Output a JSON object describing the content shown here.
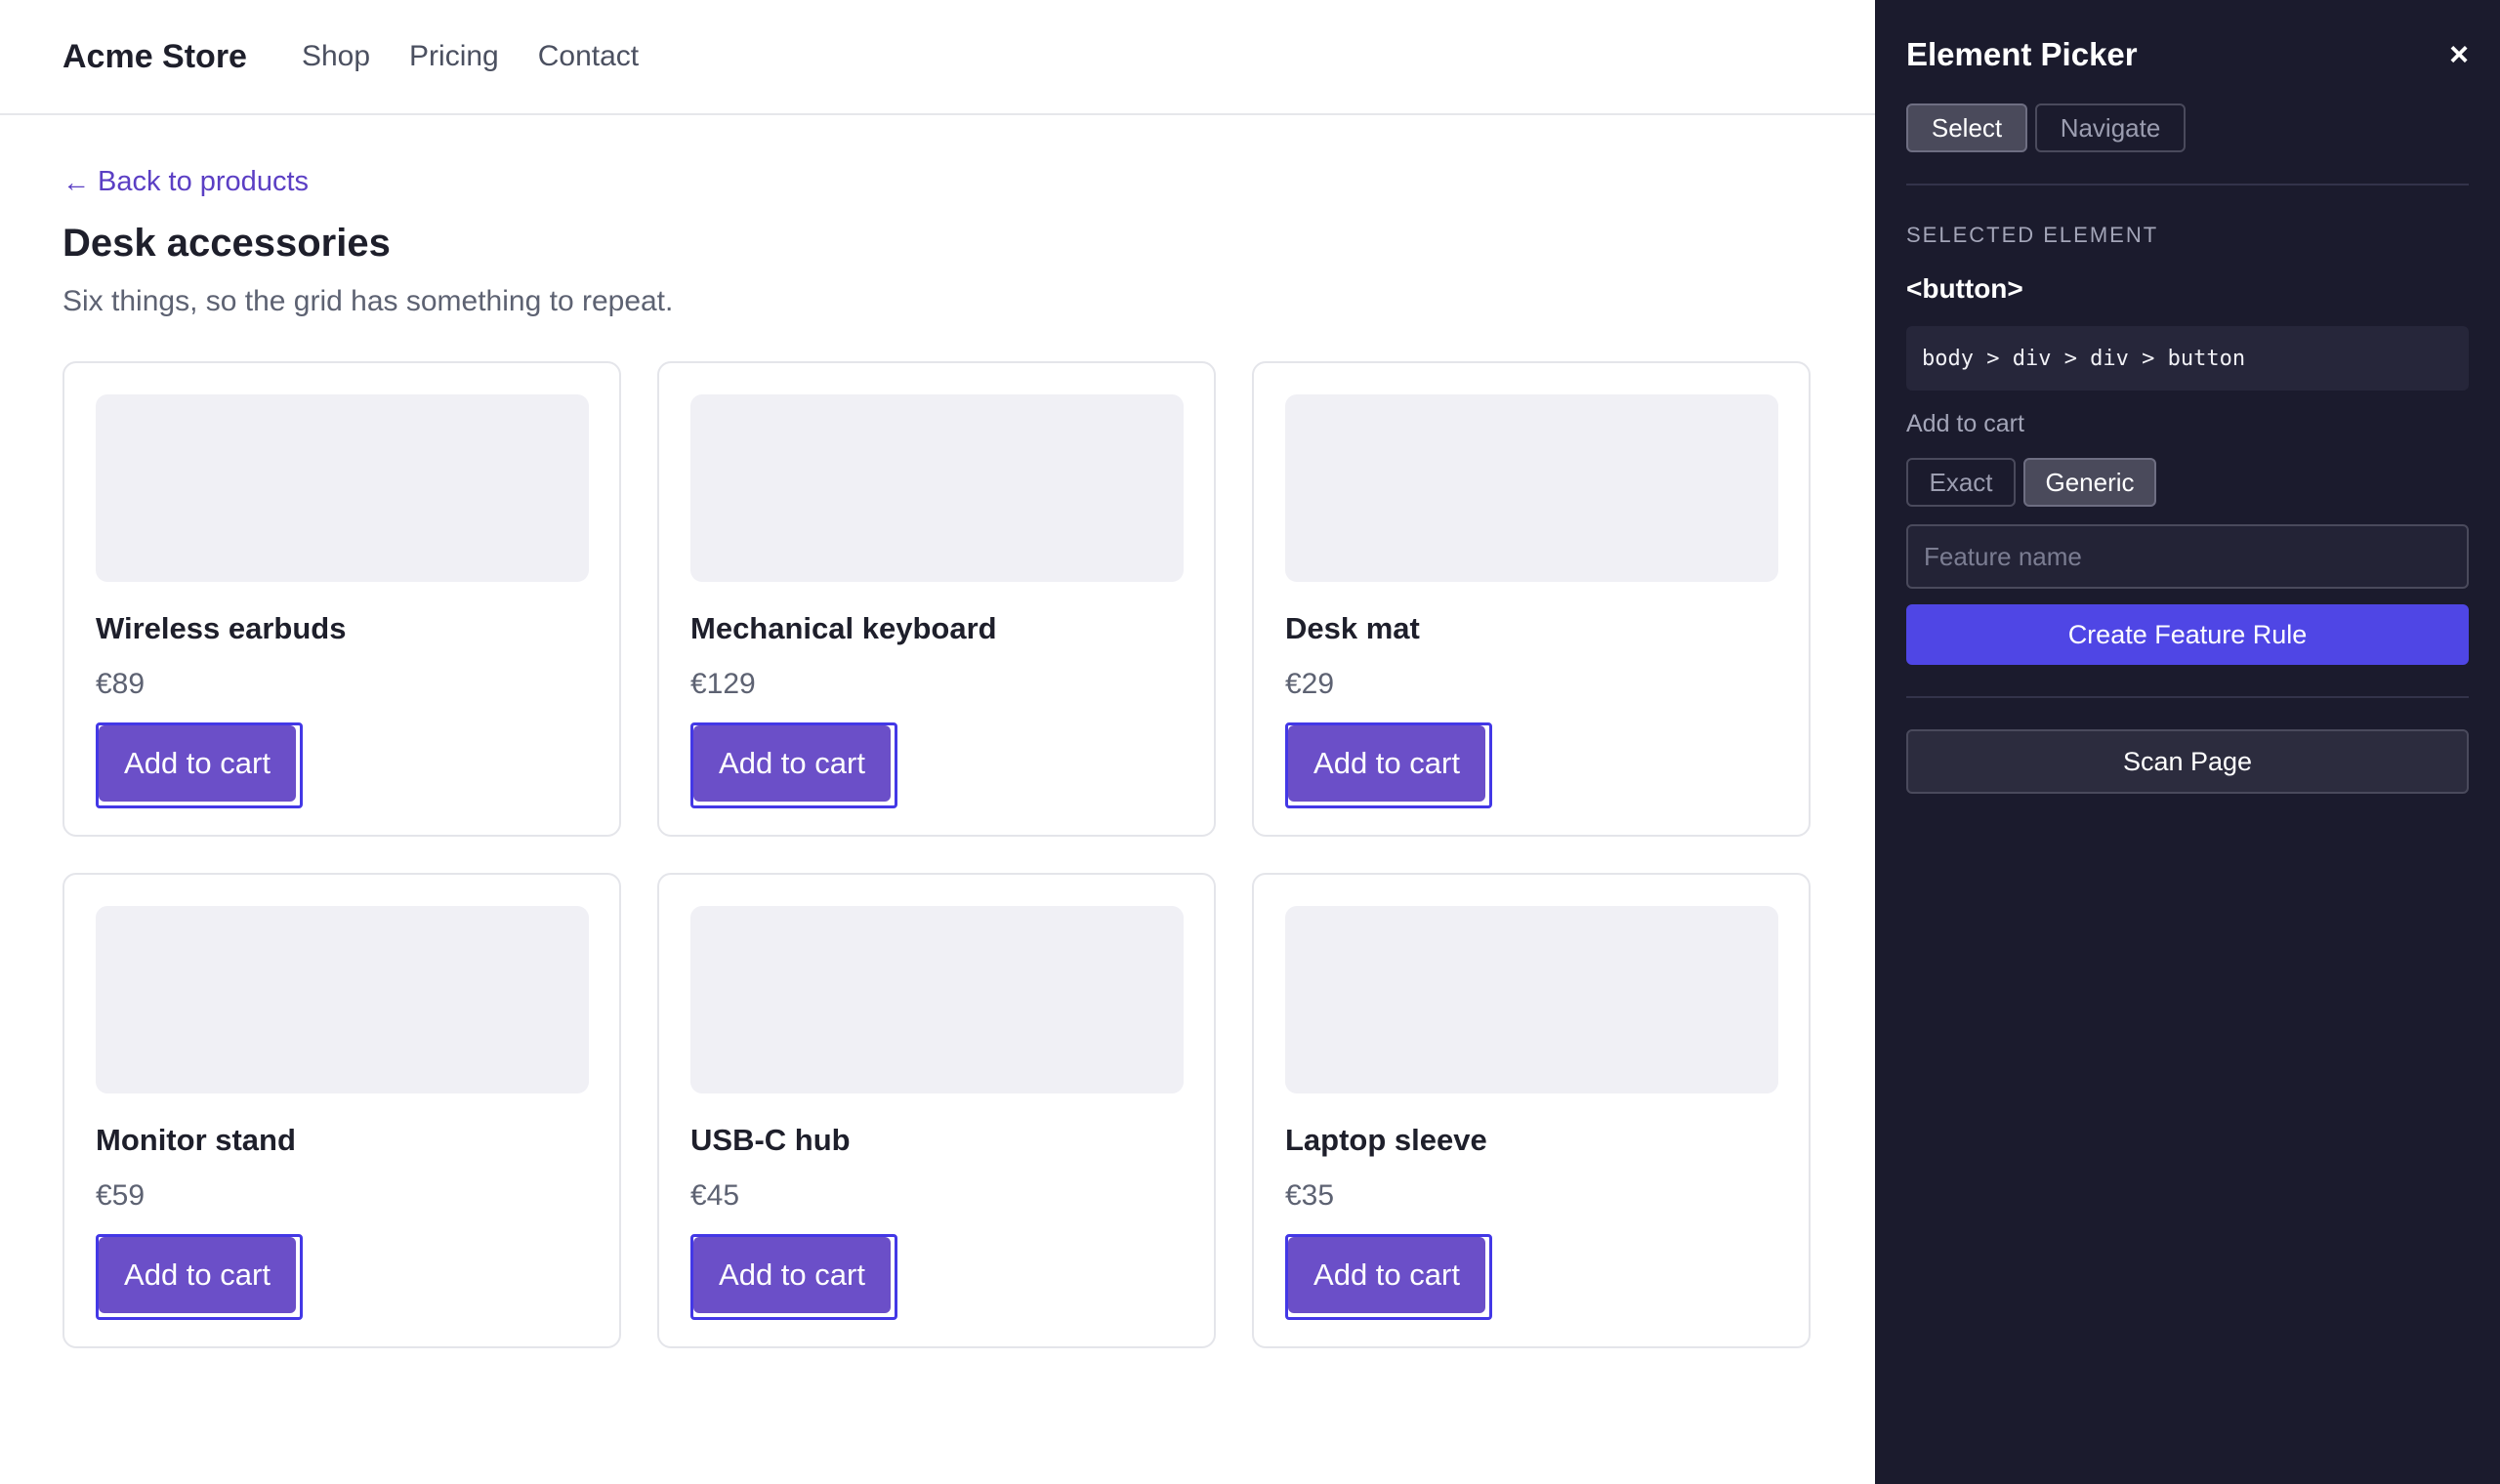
{
  "store": {
    "brand": "Acme Store",
    "nav": [
      {
        "label": "Shop"
      },
      {
        "label": "Pricing"
      },
      {
        "label": "Contact"
      }
    ],
    "back_link": {
      "arrow": "←",
      "label": "Back to products"
    },
    "title": "Desk accessories",
    "subtitle": "Six things, so the grid has something to repeat.",
    "products": [
      {
        "name": "Wireless earbuds",
        "price": "€89",
        "button": "Add to cart"
      },
      {
        "name": "Mechanical keyboard",
        "price": "€129",
        "button": "Add to cart"
      },
      {
        "name": "Desk mat",
        "price": "€29",
        "button": "Add to cart"
      },
      {
        "name": "Monitor stand",
        "price": "€59",
        "button": "Add to cart"
      },
      {
        "name": "USB-C hub",
        "price": "€45",
        "button": "Add to cart"
      },
      {
        "name": "Laptop sleeve",
        "price": "€35",
        "button": "Add to cart"
      }
    ]
  },
  "picker": {
    "title": "Element Picker",
    "close_icon": "×",
    "modes": {
      "select": "Select",
      "navigate": "Navigate",
      "active": "Select"
    },
    "section_label": "SELECTED ELEMENT",
    "tag": "<button>",
    "selector": "body > div > div > button",
    "element_text": "Add to cart",
    "match": {
      "exact": "Exact",
      "generic": "Generic",
      "active": "Generic"
    },
    "feature_input": {
      "value": "",
      "placeholder": "Feature name"
    },
    "create_button": "Create Feature Rule",
    "scan_button": "Scan Page"
  },
  "colors": {
    "accent": "#4f46e5",
    "button_purple": "#6b4fc8",
    "panel_bg": "#1b1b2d",
    "highlight_outline": "#4338e6"
  }
}
